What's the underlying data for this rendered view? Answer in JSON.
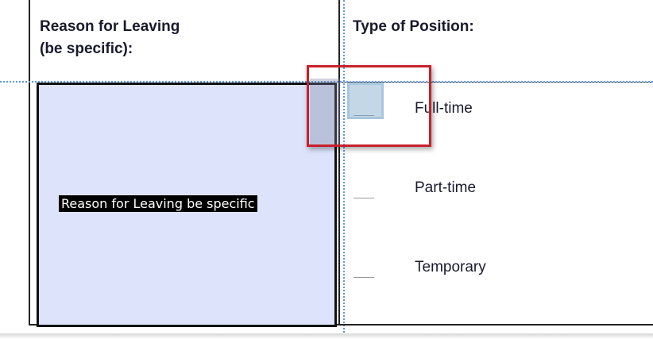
{
  "form": {
    "left_header": {
      "line1": "Reason for Leaving",
      "line2": "(be specific):"
    },
    "right_header": "Type of Position:",
    "text_field": {
      "tooltip": "Reason for Leaving be specific"
    },
    "position_options": [
      {
        "label": "Full-time",
        "checked": false,
        "highlighted": true
      },
      {
        "label": "Part-time",
        "checked": false
      },
      {
        "label": "Temporary",
        "checked": false
      }
    ]
  },
  "colors": {
    "field_fill": "#dde3fb",
    "checkbox_fill": "#c3d7e7",
    "selection_border": "#c8202a",
    "guide": "#5f97e6"
  }
}
